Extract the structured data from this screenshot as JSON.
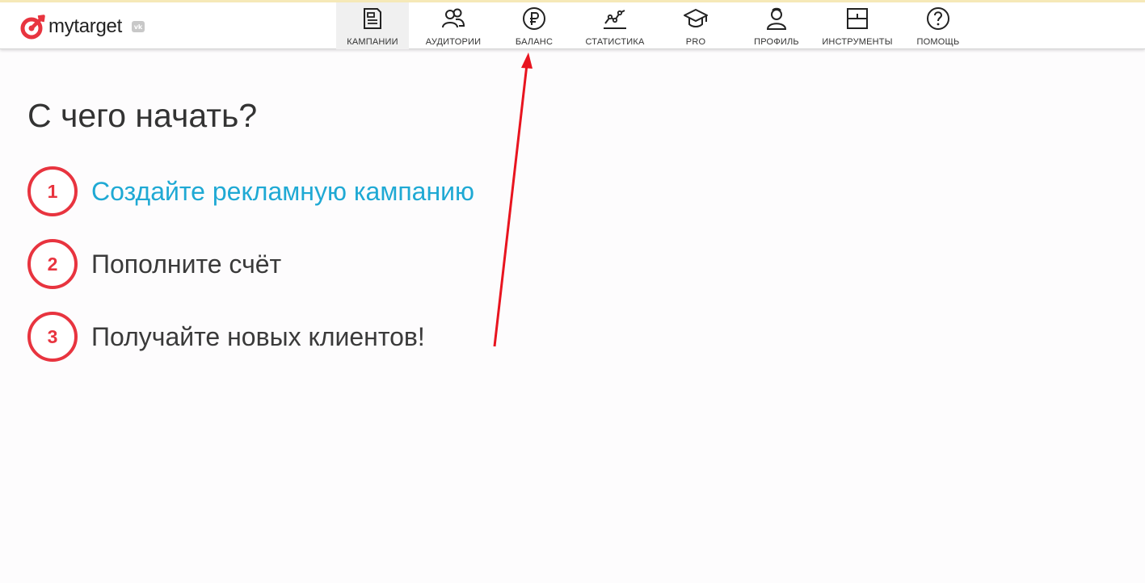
{
  "brand": {
    "name": "mytarget",
    "vk_badge": "vk",
    "accent_color": "#e8343f"
  },
  "nav": {
    "items": [
      {
        "label": "КАМПАНИИ",
        "icon": "document-icon",
        "active": true
      },
      {
        "label": "АУДИТОРИИ",
        "icon": "users-icon",
        "active": false
      },
      {
        "label": "БАЛАНС",
        "icon": "ruble-icon",
        "active": false
      },
      {
        "label": "СТАТИСТИКА",
        "icon": "chart-icon",
        "active": false
      },
      {
        "label": "PRO",
        "icon": "graduation-cap-icon",
        "active": false
      },
      {
        "label": "ПРОФИЛЬ",
        "icon": "profile-icon",
        "active": false
      },
      {
        "label": "ИНСТРУМЕНТЫ",
        "icon": "tools-icon",
        "active": false
      },
      {
        "label": "ПОМОЩЬ",
        "icon": "help-icon",
        "active": false
      }
    ]
  },
  "main": {
    "title": "С чего начать?",
    "steps": [
      {
        "number": "1",
        "text": "Создайте рекламную кампанию",
        "link_color": "#1fa9d4"
      },
      {
        "number": "2",
        "text": "Пополните счёт"
      },
      {
        "number": "3",
        "text": "Получайте новых клиентов!"
      }
    ]
  },
  "annotation": {
    "arrow_color": "#e8141f",
    "arrow_points_to": "БАЛАНС"
  }
}
